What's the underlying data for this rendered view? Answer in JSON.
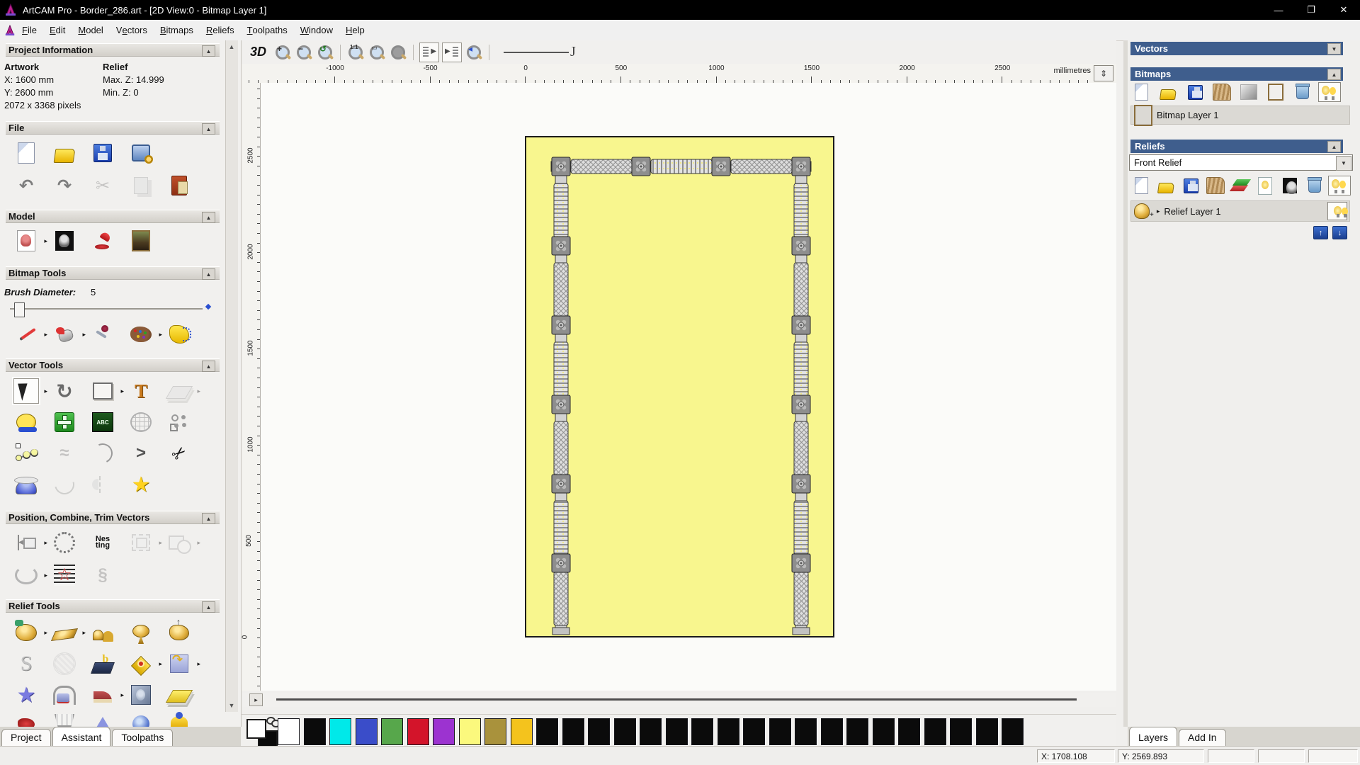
{
  "window": {
    "title": "ArtCAM Pro - Border_286.art - [2D View:0 - Bitmap Layer 1]",
    "controls": {
      "minimize": "—",
      "restore": "❐",
      "close": "✕"
    }
  },
  "menu": {
    "items": [
      {
        "label": "File",
        "accel": 0
      },
      {
        "label": "Edit",
        "accel": 0
      },
      {
        "label": "Model",
        "accel": 0
      },
      {
        "label": "Vectors",
        "accel": 1
      },
      {
        "label": "Bitmaps",
        "accel": 0
      },
      {
        "label": "Reliefs",
        "accel": 0
      },
      {
        "label": "Toolpaths",
        "accel": 0
      },
      {
        "label": "Window",
        "accel": 0
      },
      {
        "label": "Help",
        "accel": 0
      }
    ]
  },
  "left_panel": {
    "project_information": {
      "title": "Project Information",
      "artwork_label": "Artwork",
      "relief_label": "Relief",
      "x": "X: 1600 mm",
      "y": "Y: 2600 mm",
      "max_z": "Max. Z: 14.999",
      "min_z": "Min. Z: 0",
      "pixels": "2072 x 3368 pixels"
    },
    "section_titles": {
      "file": "File",
      "model": "Model",
      "bitmap_tools": "Bitmap Tools",
      "vector_tools": "Vector Tools",
      "position": "Position, Combine, Trim Vectors",
      "relief_tools": "Relief Tools"
    },
    "brush_diameter_label": "Brush Diameter:",
    "brush_diameter_value": "5",
    "abc_label": "ABC",
    "nesting_line1": "Nes",
    "nesting_line2": "ting",
    "tabs": [
      "Project",
      "Assistant",
      "Toolpaths"
    ],
    "active_tab": "Assistant"
  },
  "toolbar": {
    "btn_3d": "3D",
    "j_mark": "J"
  },
  "rulers": {
    "h_labels": [
      "-1000",
      "-500",
      "0",
      "500",
      "1000",
      "1500",
      "2000",
      "2500"
    ],
    "v_labels": [
      "2500",
      "2000",
      "1500",
      "1000",
      "500",
      "0"
    ],
    "units": "millimetres"
  },
  "right_panel": {
    "vectors_title": "Vectors",
    "bitmaps_title": "Bitmaps",
    "bitmap_layer_name": "Bitmap Layer 1",
    "reliefs_title": "Reliefs",
    "relief_dropdown_value": "Front Relief",
    "relief_layer_name": "Relief Layer 1",
    "tabs": [
      "Layers",
      "Add In"
    ],
    "active_tab": "Layers"
  },
  "status_bar": {
    "x": "X: 1708.108",
    "y": "Y: 2569.893"
  },
  "palette": {
    "colors": [
      "#ffffff",
      "#0b0b0b",
      "#00e9e9",
      "#3a4dc9",
      "#57a74b",
      "#d3142a",
      "#9c33d0",
      "#fbf97d",
      "#a9923c",
      "#f4c31d",
      "#0b0b0b",
      "#0b0b0b",
      "#0b0b0b",
      "#0b0b0b",
      "#0b0b0b",
      "#0b0b0b",
      "#0b0b0b",
      "#0b0b0b",
      "#0b0b0b",
      "#0b0b0b",
      "#0b0b0b",
      "#0b0b0b",
      "#0b0b0b",
      "#0b0b0b",
      "#0b0b0b",
      "#0b0b0b",
      "#0b0b0b",
      "#0b0b0b",
      "#0b0b0b"
    ]
  },
  "glyphs": {
    "flyout": "▸",
    "collapse": "▲",
    "dropdown": "▼",
    "scroll_up": "▲",
    "scroll_down": "▼",
    "scroll_right": "▸",
    "units_toggle": "⇕",
    "undo": "↶",
    "redo": "↷",
    "cut": "✂",
    "transform": "↻",
    "chevron": ">",
    "squiggle": "≈",
    "star": "★",
    "star_outline": "☆",
    "letter_s": "S",
    "letter_t": "T",
    "letter_b": "b",
    "twist": "§",
    "layer_up": "↑",
    "layer_down": "↓",
    "plus": "+",
    "minus": "−",
    "mag_plus": "+",
    "mag_minus": "−",
    "mag_prev": "↺",
    "mag_11": "1:1",
    "corner_dots": "⁙"
  },
  "colors": {
    "header_blue": "#3f5e8d",
    "canvas_yellow": "#f8f68e",
    "titlebar_black": "#000000",
    "selection_red": "#c02020"
  }
}
